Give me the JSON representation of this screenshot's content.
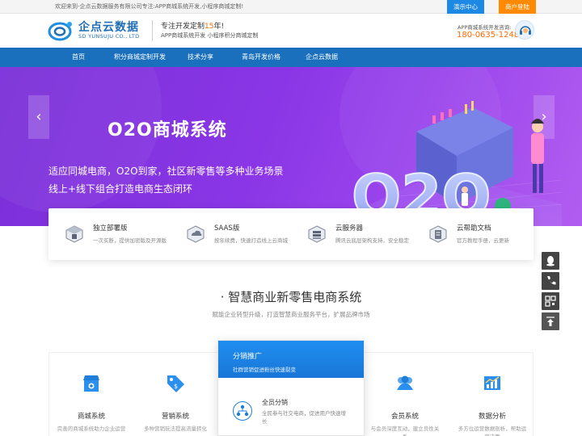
{
  "topbar": {
    "welcome": "欢迎来到-企点云数据服务有限公司专注:APP商城系统开发,小程序商城定制!",
    "demo_button": "演示中心",
    "merchant_button": "商户登陆"
  },
  "header": {
    "logo_cn": "企点云数据",
    "logo_en": "SD YUNSUJU CO., LTD",
    "slogan_prefix": "专注开发定制",
    "slogan_years": "15",
    "slogan_suffix": "年!",
    "slogan_sub": "APP商城系统开发 小程序积分商城定制",
    "hotline_label": "APP商城系统开发咨询:",
    "hotline_number": "180-0635-1248"
  },
  "nav": {
    "items": [
      "首页",
      "积分商城定制开发",
      "技术分享",
      "青岛开发价格",
      "企点云数据"
    ]
  },
  "banner": {
    "title": "O2O商城系统",
    "line1": "适应同城电商，O2O到家，社区新零售等多种业务场景",
    "line2": "线上+线下组合打造电商生态闭环",
    "prev_arrow": "‹",
    "next_arrow": "›",
    "illustration_text": "O2O"
  },
  "features": [
    {
      "title": "独立部署版",
      "desc": "一次买断，提供加密版及开源版",
      "icon": "server-box-icon"
    },
    {
      "title": "SAAS版",
      "desc": "按年续费，快速打造线上云商城",
      "icon": "cloud-layers-icon"
    },
    {
      "title": "云服务器",
      "desc": "腾讯云底层架构支持，安全稳定",
      "icon": "cloud-server-icon"
    },
    {
      "title": "云帮助文档",
      "desc": "官方教程手册，云更新",
      "icon": "document-icon"
    }
  ],
  "section": {
    "title": "· 智慧商业新零售电商系统",
    "subtitle": "赋能企业转型升级，打造智慧商业服务平台，扩展品牌市场"
  },
  "cards": [
    {
      "title": "商城系统",
      "desc": "完善的商城系统助力企业运营",
      "icon": "shop-icon"
    },
    {
      "title": "营销系统",
      "desc": "多种营销玩法提高流量转化",
      "icon": "tag-icon"
    },
    {
      "title": "会员系统",
      "desc": "与会员深度互动，建立良性关系",
      "icon": "members-icon"
    },
    {
      "title": "数据分析",
      "desc": "多方位运营数据剖析，帮助运营决策",
      "icon": "chart-icon"
    }
  ],
  "featured_card": {
    "title": "分销推广",
    "desc": "社群营销促进粉丝快速裂变",
    "sub_title": "全员分销",
    "sub_desc": "全民参与社交电商，促进用户快速增长",
    "icon": "network-icon"
  },
  "colors": {
    "brand_blue": "#1a70bd",
    "accent_orange": "#ff6a00",
    "banner_purple": "#8a36e6"
  }
}
